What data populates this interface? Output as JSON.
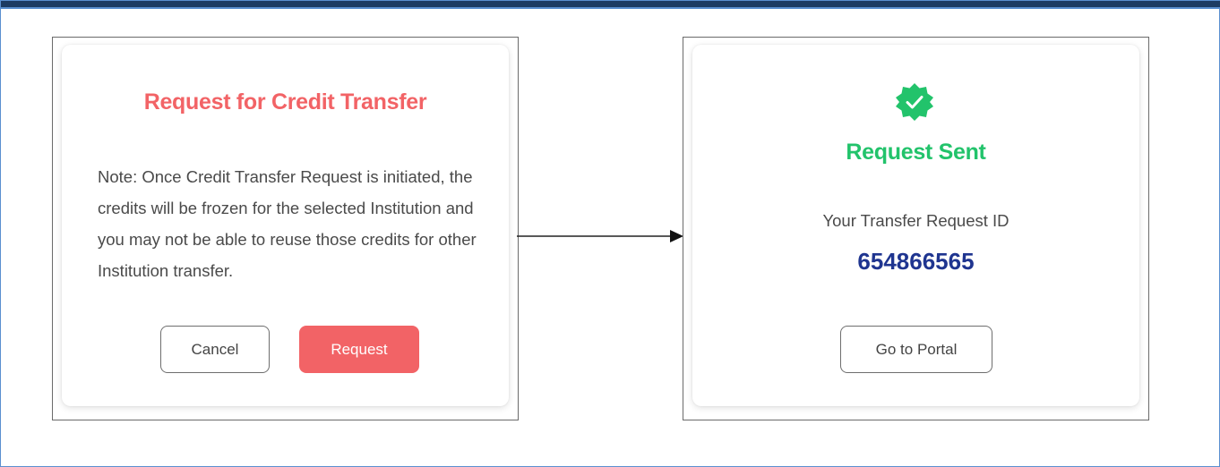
{
  "colors": {
    "accent_red": "#f26366",
    "accent_green": "#22c36b",
    "id_blue": "#1f3590",
    "header_bar": "#1d3b63"
  },
  "left_dialog": {
    "title": "Request for Credit Transfer",
    "note": "Note: Once Credit Transfer Request is initiated, the credits will be frozen for the selected Institution and you may not be able to reuse those credits for other Institution transfer.",
    "cancel_label": "Cancel",
    "request_label": "Request"
  },
  "right_dialog": {
    "icon": "verified-check-badge-icon",
    "title": "Request Sent",
    "id_label": "Your Transfer Request ID",
    "id_value": "654866565",
    "portal_label": "Go to Portal"
  }
}
